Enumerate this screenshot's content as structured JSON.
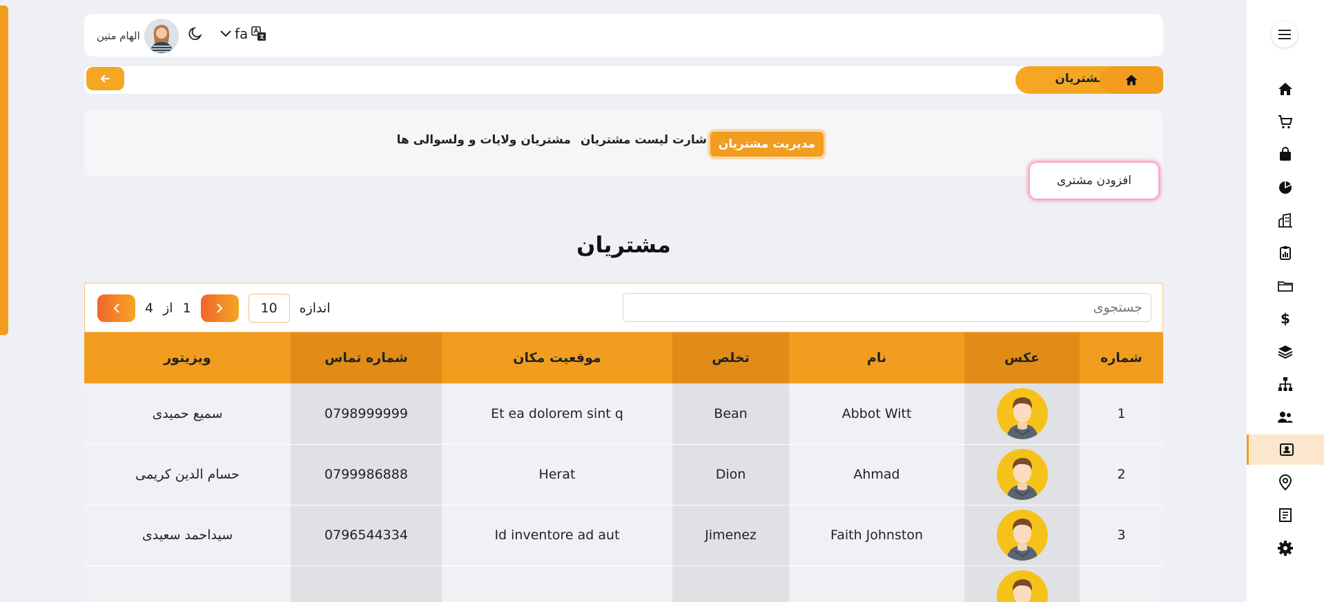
{
  "header": {
    "user_name": "الهام متین",
    "language": "fa"
  },
  "breadcrumb": {
    "current": "مشتریان"
  },
  "tabs": [
    {
      "label": "مدیریت مشتریان",
      "active": true
    },
    {
      "label": "شارت لیست مشتریان",
      "active": false
    },
    {
      "label": "مشتریان ولایات و ولسوالی ها",
      "active": false
    }
  ],
  "add_button": "افزودن مشتری",
  "page_title": "مشتریان",
  "filters": {
    "search_placeholder": "جستجوی",
    "size_label": "اندازه",
    "size_value": "10",
    "current_page": "1",
    "of_label": "از",
    "total_pages": "4"
  },
  "table": {
    "columns": [
      "شماره",
      "عکس",
      "نام",
      "تخلص",
      "موقعیت مکان",
      "شماره تماس",
      "ویزیتور"
    ],
    "rows": [
      {
        "no": "1",
        "name": "Abbot Witt",
        "lastname": "Bean",
        "location": "Et ea dolorem sint q",
        "phone": "0798999999",
        "visitor": "سمیع حمیدی"
      },
      {
        "no": "2",
        "name": "Ahmad",
        "lastname": "Dion",
        "location": "Herat",
        "phone": "0799986888",
        "visitor": "حسام الدین کریمی"
      },
      {
        "no": "3",
        "name": "Faith Johnston",
        "lastname": "Jimenez",
        "location": "Id inventore ad aut",
        "phone": "0796544334",
        "visitor": "سیداحمد سعیدی"
      },
      {
        "no": "",
        "name": "",
        "lastname": "",
        "location": "",
        "phone": "",
        "visitor": ""
      }
    ]
  },
  "sidebar": {
    "items": [
      "home-icon",
      "cart-icon",
      "bag-icon",
      "pie-chart-icon",
      "building-icon",
      "clipboard-icon",
      "folder-icon",
      "dollar-icon",
      "layers-icon",
      "org-chart-icon",
      "users-icon",
      "contact-card-icon",
      "location-pin-icon",
      "document-icon",
      "gear-icon"
    ],
    "active_index": 11
  },
  "colors": {
    "accent": "#f29d1f",
    "accent_dark": "#e08c17",
    "background": "#eef0f6"
  }
}
